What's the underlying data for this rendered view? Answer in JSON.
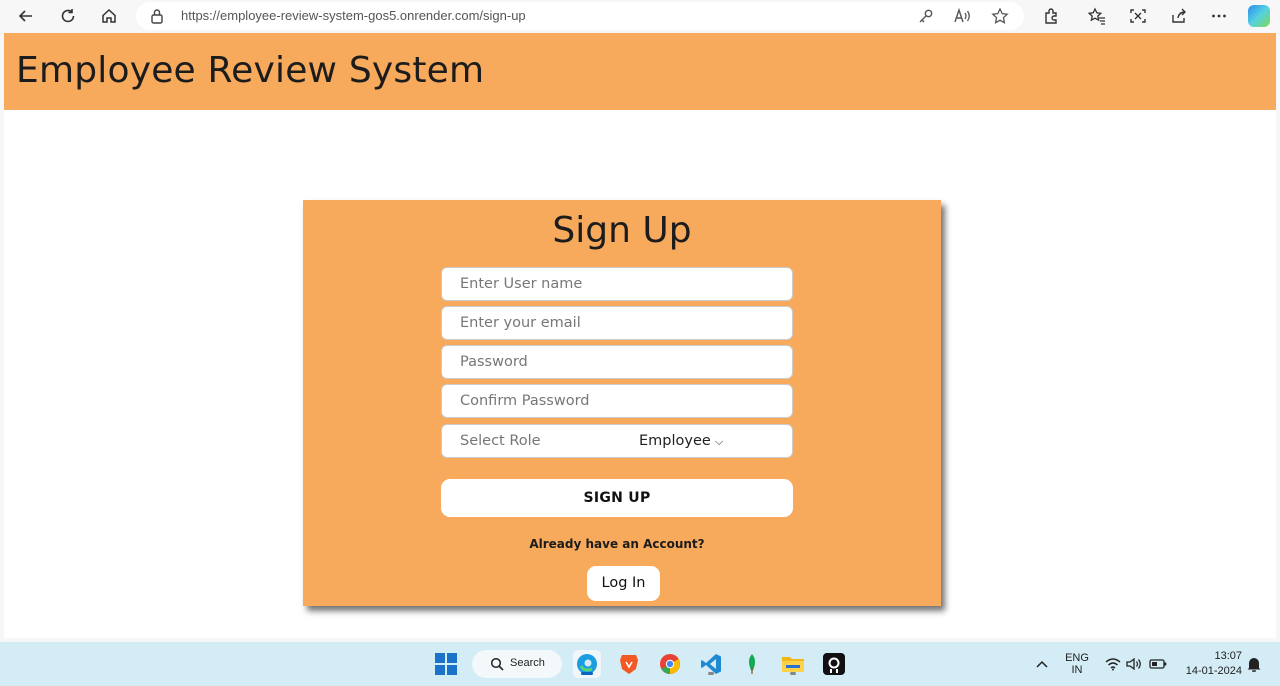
{
  "browser": {
    "url": "https://employee-review-system-gos5.onrender.com/sign-up",
    "icons": [
      "back-icon",
      "refresh-icon",
      "home-icon",
      "lock-icon",
      "key-icon",
      "read-aloud-icon",
      "favorite-star-icon",
      "extensions-icon",
      "favorites-icon",
      "screenshot-icon",
      "share-icon",
      "more-icon",
      "copilot-icon"
    ]
  },
  "header": {
    "title": "Employee Review System"
  },
  "form": {
    "title": "Sign Up",
    "username_placeholder": "Enter User name",
    "email_placeholder": "Enter your email",
    "password_placeholder": "Password",
    "confirm_placeholder": "Confirm Password",
    "role_label": "Select Role",
    "role_value": "Employee",
    "submit_label": "SIGN UP",
    "already_text": "Already have an Account?",
    "login_label": "Log In"
  },
  "colors": {
    "accent": "#f7a95c",
    "card_bg": "#f7a95c"
  },
  "taskbar": {
    "search_label": "Search",
    "lang_top": "ENG",
    "lang_bottom": "IN",
    "time": "13:07",
    "date": "14-01-2024"
  }
}
